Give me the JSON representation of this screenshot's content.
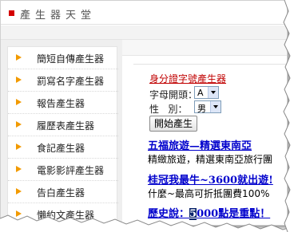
{
  "header": {
    "title": "產生器天堂"
  },
  "sidebar": {
    "items": [
      {
        "label": "簡短自傳產生器"
      },
      {
        "label": "罰寫名字產生器"
      },
      {
        "label": "報告產生器"
      },
      {
        "label": "履歷表產生器"
      },
      {
        "label": "食記產生器"
      },
      {
        "label": "電影影評產生器"
      },
      {
        "label": "告白產生器"
      },
      {
        "label": "懶約文產生器"
      }
    ]
  },
  "generator": {
    "title": "身分證字號產生器",
    "letter_label": "字母開頭：",
    "letter_value": "A",
    "gender_label_1": "性",
    "gender_label_2": "別：",
    "gender_value": "男",
    "submit_label": "開始產生"
  },
  "ads": [
    {
      "title": "五福旅遊—精選東南亞",
      "desc": "精緻旅遊，精選東南亞旅行團"
    },
    {
      "title": "桂冠我最牛~3600就出遊!",
      "desc": "什麼~最高可折抵團費100%"
    },
    {
      "title_prefix": "歷史說：",
      "title_highlight": "5",
      "title_suffix": "000點是重點！"
    }
  ]
}
